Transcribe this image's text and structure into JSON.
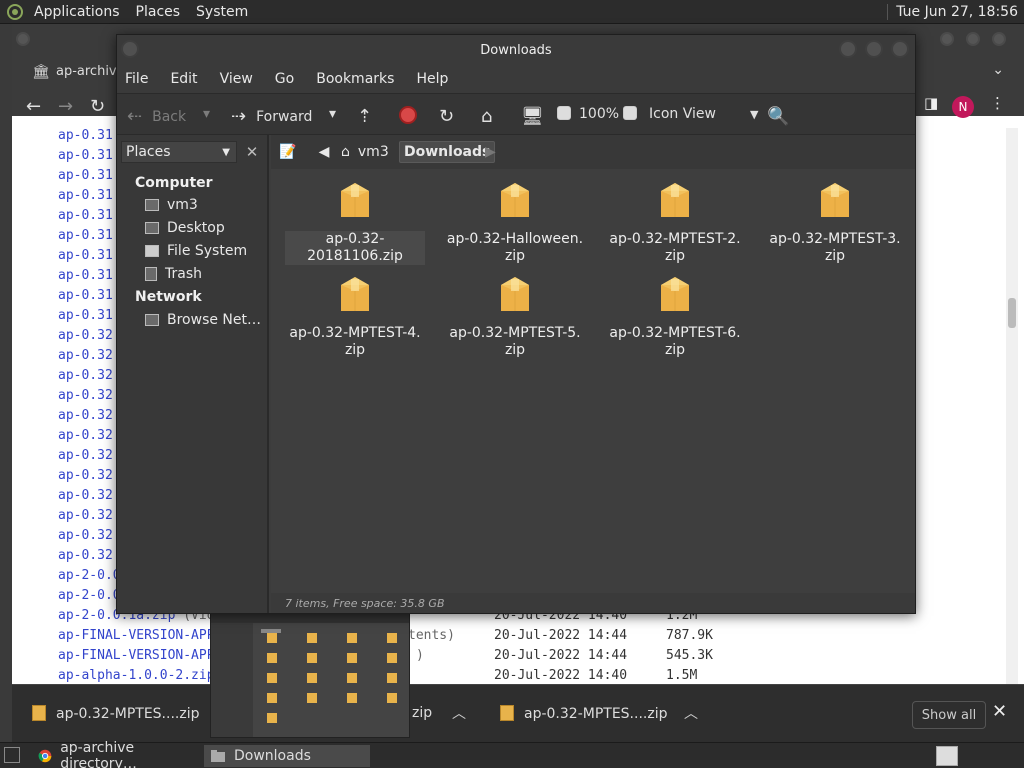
{
  "top_panel": {
    "menus": [
      "Applications",
      "Places",
      "System"
    ],
    "clock": "Tue Jun 27, 18:56"
  },
  "chrome": {
    "tab_title": "ap-archive",
    "avatar_letter": "N",
    "listing": [
      {
        "name": "ap-0.31",
        "desc": "",
        "date": "",
        "size": ""
      },
      {
        "name": "ap-0.31",
        "desc": "",
        "date": "",
        "size": ""
      },
      {
        "name": "ap-0.31",
        "desc": "",
        "date": "",
        "size": ""
      },
      {
        "name": "ap-0.31",
        "desc": "",
        "date": "",
        "size": ""
      },
      {
        "name": "ap-0.31",
        "desc": "",
        "date": "",
        "size": ""
      },
      {
        "name": "ap-0.31",
        "desc": "",
        "date": "",
        "size": ""
      },
      {
        "name": "ap-0.31",
        "desc": "",
        "date": "",
        "size": ""
      },
      {
        "name": "ap-0.31",
        "desc": "",
        "date": "",
        "size": ""
      },
      {
        "name": "ap-0.31",
        "desc": "",
        "date": "",
        "size": ""
      },
      {
        "name": "ap-0.31",
        "desc": "",
        "date": "",
        "size": ""
      },
      {
        "name": "ap-0.32",
        "desc": "",
        "date": "",
        "size": ""
      },
      {
        "name": "ap-0.32",
        "desc": "",
        "date": "",
        "size": ""
      },
      {
        "name": "ap-0.32",
        "desc": "",
        "date": "",
        "size": ""
      },
      {
        "name": "ap-0.32",
        "desc": "",
        "date": "",
        "size": ""
      },
      {
        "name": "ap-0.32",
        "desc": "",
        "date": "",
        "size": ""
      },
      {
        "name": "ap-0.32",
        "desc": "",
        "date": "",
        "size": ""
      },
      {
        "name": "ap-0.32",
        "desc": "",
        "date": "",
        "size": ""
      },
      {
        "name": "ap-0.32",
        "desc": "",
        "date": "",
        "size": ""
      },
      {
        "name": "ap-0.32",
        "desc": "",
        "date": "",
        "size": ""
      },
      {
        "name": "ap-0.32",
        "desc": "",
        "date": "",
        "size": ""
      },
      {
        "name": "ap-0.32",
        "desc": "",
        "date": "",
        "size": ""
      },
      {
        "name": "ap-0.32",
        "desc": "",
        "date": "",
        "size": ""
      },
      {
        "name": "ap-2-0.0",
        "desc": "",
        "date": "",
        "size": ""
      },
      {
        "name": "ap-2-0.0",
        "desc": "",
        "date": "",
        "size": ""
      },
      {
        "name": "ap-2-0.0.1a.zip",
        "desc": " (Vid",
        "date": "20-Jul-2022 14:40",
        "size": "1.2M"
      },
      {
        "name": "ap-FINAL-VERSION-APP",
        "desc": "",
        "date": "20-Jul-2022 14:44",
        "size": "787.9K"
      },
      {
        "name": "ap-FINAL-VERSION-APP",
        "desc": "",
        "date": "20-Jul-2022 14:44",
        "size": "545.3K"
      },
      {
        "name": "ap-alpha-1.0.0-2.zip",
        "desc": "",
        "date": "20-Jul-2022 14:40",
        "size": "1.5M"
      }
    ],
    "listing_fragments": [
      "tents)",
      ")"
    ]
  },
  "download_bar": {
    "items": [
      "ap-0.32-MPTES....zip",
      "zip",
      "ap-0.32-MPTES....zip"
    ],
    "show_all": "Show all",
    "close": "✕"
  },
  "taskbar": {
    "tasks": [
      "ap-archive directory…",
      "Downloads"
    ]
  },
  "nautilus": {
    "title": "Downloads",
    "menus": [
      "File",
      "Edit",
      "View",
      "Go",
      "Bookmarks",
      "Help"
    ],
    "toolbar": {
      "back": "Back",
      "forward": "Forward",
      "zoom": "100%",
      "view_mode": "Icon View"
    },
    "sidebar": {
      "select_label": "Places",
      "computer_header": "Computer",
      "computer_items": [
        "vm3",
        "Desktop",
        "File System",
        "Trash"
      ],
      "network_header": "Network",
      "network_items": [
        "Browse Net…"
      ]
    },
    "path": [
      "vm3",
      "Downloads"
    ],
    "files": [
      [
        "ap-0.32-20181106.zip"
      ],
      [
        "ap-0.32-Halloween.",
        "zip"
      ],
      [
        "ap-0.32-MPTEST-2.",
        "zip"
      ],
      [
        "ap-0.32-MPTEST-3.",
        "zip"
      ],
      [
        "ap-0.32-MPTEST-4.",
        "zip"
      ],
      [
        "ap-0.32-MPTEST-5.",
        "zip"
      ],
      [
        "ap-0.32-MPTEST-6.",
        "zip"
      ]
    ],
    "status": "7 items, Free space: 35.8 GB"
  }
}
